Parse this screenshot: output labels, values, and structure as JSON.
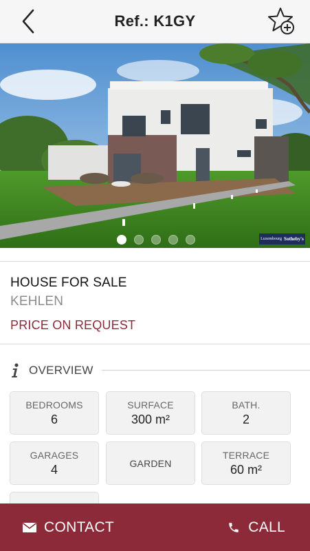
{
  "header": {
    "title": "Ref.: K1GY"
  },
  "gallery": {
    "image_count": 5,
    "active_index": 0,
    "watermark": {
      "line1": "Luxembourg",
      "line2": "Sotheby's"
    }
  },
  "listing": {
    "type": "HOUSE FOR SALE",
    "location": "KEHLEN",
    "price": "PRICE ON REQUEST"
  },
  "overview": {
    "label": "OVERVIEW",
    "tiles": [
      {
        "label": "BEDROOMS",
        "value": "6"
      },
      {
        "label": "SURFACE",
        "value": "300 m²"
      },
      {
        "label": "BATH.",
        "value": "2"
      },
      {
        "label": "GARAGES",
        "value": "4"
      },
      {
        "label": "GARDEN",
        "value": ""
      },
      {
        "label": "TERRACE",
        "value": "60 m²"
      }
    ]
  },
  "actions": {
    "contact": "CONTACT",
    "call": "CALL"
  },
  "colors": {
    "accent": "#8c2a3a",
    "header_bg": "#f6f6f6",
    "tile_bg": "#f2f2f2"
  },
  "icons": [
    "back-icon",
    "favorite-add-icon",
    "info-icon",
    "mail-icon",
    "phone-icon"
  ]
}
